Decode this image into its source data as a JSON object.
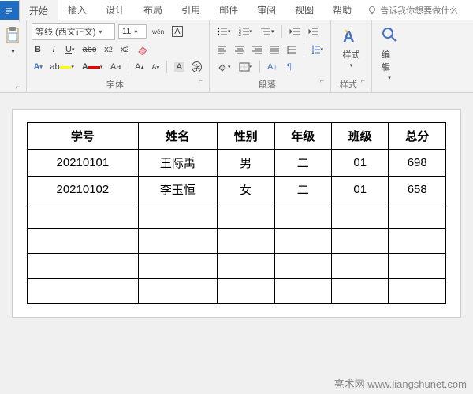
{
  "tabs": {
    "file": "",
    "start": "开始",
    "insert": "插入",
    "design": "设计",
    "layout": "布局",
    "references": "引用",
    "mail": "邮件",
    "review": "审阅",
    "view": "视图",
    "help": "帮助",
    "tellme": "告诉我你想要做什么"
  },
  "font": {
    "name": "等线 (西文正文)",
    "size": "11",
    "group_label": "字体"
  },
  "para": {
    "group_label": "段落"
  },
  "styles": {
    "label": "样式",
    "group_label": "样式"
  },
  "editing": {
    "label": "编辑"
  },
  "table": {
    "headers": [
      "学号",
      "姓名",
      "性别",
      "年级",
      "班级",
      "总分"
    ],
    "rows": [
      [
        "20210101",
        "王际禹",
        "男",
        "二",
        "01",
        "698"
      ],
      [
        "20210102",
        "李玉恒",
        "女",
        "二",
        "01",
        "658"
      ],
      [
        "",
        "",
        "",
        "",
        "",
        ""
      ],
      [
        "",
        "",
        "",
        "",
        "",
        ""
      ],
      [
        "",
        "",
        "",
        "",
        "",
        ""
      ],
      [
        "",
        "",
        "",
        "",
        "",
        ""
      ]
    ]
  },
  "watermark": "亮术网 www.liangshunet.com"
}
